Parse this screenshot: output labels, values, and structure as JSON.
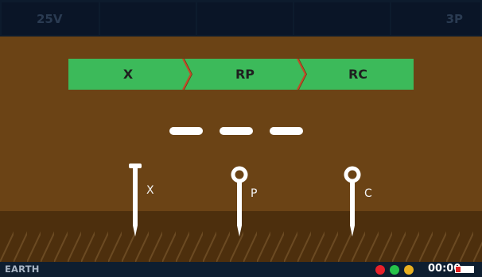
{
  "topbar": {
    "voltage": "25V",
    "cell2": "",
    "cell3": "",
    "cell4": "",
    "mode": "3P"
  },
  "steps": [
    {
      "label": "X",
      "color": "#3cba5a"
    },
    {
      "label": "RP",
      "color": "#3cba5a"
    },
    {
      "label": "RC",
      "color": "#3cba5a"
    }
  ],
  "chevron_color": "#c24a2a",
  "reading": "– – –",
  "stakes": [
    {
      "label": "X",
      "icon": "nail-stake-icon"
    },
    {
      "label": "P",
      "icon": "ring-stake-icon"
    },
    {
      "label": "C",
      "icon": "ring-stake-icon"
    }
  ],
  "colors": {
    "background": "#6b4315",
    "ground": "#4d2f0d",
    "topbar": "#0d1b2d"
  },
  "bottombar": {
    "mode_label": "EARTH",
    "indicators": [
      {
        "name": "red",
        "color": "#e8202a"
      },
      {
        "name": "green",
        "color": "#26c24a"
      },
      {
        "name": "yellow",
        "color": "#e8b020"
      }
    ],
    "time": "00:00",
    "battery_level": 0.25
  }
}
